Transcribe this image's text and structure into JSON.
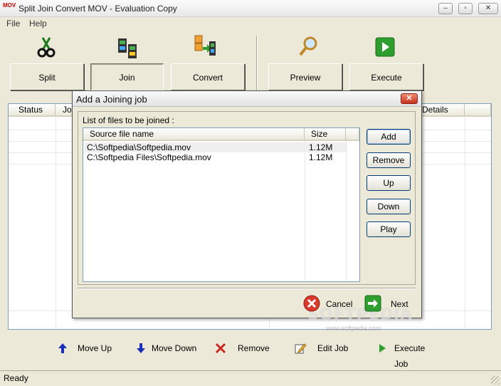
{
  "window": {
    "app_icon_text": "MOV",
    "title": "Split Join Convert MOV - Evaluation Copy",
    "minimize": "–",
    "restore": "▫",
    "close": "✕"
  },
  "menu": {
    "file": "File",
    "help": "Help"
  },
  "toolbar": {
    "split": "Split",
    "join": "Join",
    "convert": "Convert",
    "preview": "Preview",
    "execute": "Execute"
  },
  "main_list": {
    "columns": [
      "Status",
      "Jo",
      "Details"
    ]
  },
  "actions": {
    "move_up": "Move Up",
    "move_down": "Move Down",
    "remove": "Remove",
    "edit_job": "Edit Job",
    "execute_job": "Execute Job"
  },
  "status": {
    "text": "Ready"
  },
  "dialog": {
    "title": "Add a Joining job",
    "close": "✕",
    "list_label": "List of files to be joined :",
    "columns": {
      "source": "Source file name",
      "size": "Size"
    },
    "files": [
      {
        "name": "C:\\Softpedia\\Softpedia.mov",
        "size": "1.12M"
      },
      {
        "name": "C:\\Softpedia Files\\Softpedia.mov",
        "size": "1.12M"
      }
    ],
    "buttons": {
      "add": "Add",
      "remove": "Remove",
      "up": "Up",
      "down": "Down",
      "play": "Play"
    },
    "cancel": "Cancel",
    "next": "Next"
  },
  "watermark": {
    "text": "SOFTPEDIA",
    "sub": "www.softpedia.com"
  },
  "colors": {
    "accent_green": "#2e9e2e",
    "accent_red": "#c8281e",
    "arrow_blue": "#1a2fb8"
  }
}
